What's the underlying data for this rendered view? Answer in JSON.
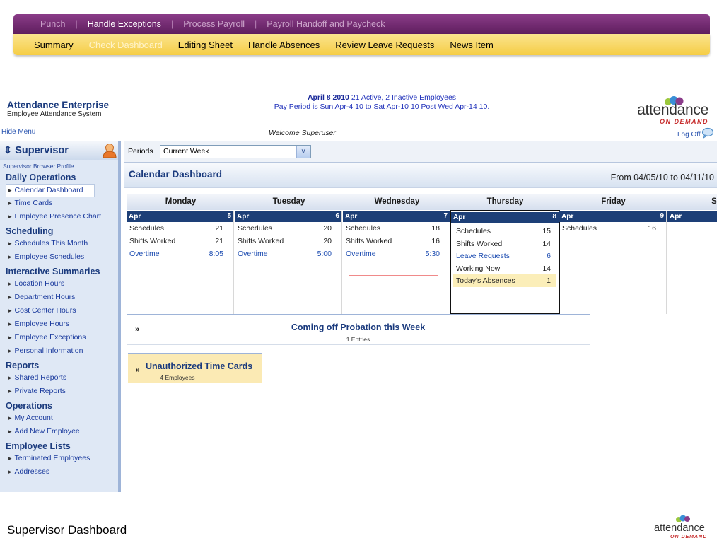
{
  "topnav": {
    "level1": [
      {
        "label": "Punch",
        "active": false
      },
      {
        "label": "Handle Exceptions",
        "active": true
      },
      {
        "label": "Process Payroll",
        "active": false
      },
      {
        "label": "Payroll Handoff and Paycheck",
        "active": false
      }
    ],
    "level2": [
      {
        "label": "Summary",
        "faded": false
      },
      {
        "label": "Check Dashboard",
        "faded": true
      },
      {
        "label": "Editing Sheet",
        "faded": false
      },
      {
        "label": "Handle Absences",
        "faded": false
      },
      {
        "label": "Review Leave Requests",
        "faded": false
      },
      {
        "label": "News Item",
        "faded": false
      }
    ]
  },
  "header": {
    "app_title": "Attendance Enterprise",
    "app_subtitle": "Employee Attendance System",
    "hide_menu": "Hide Menu",
    "date": "April 8 2010",
    "employees": "21 Active, 2 Inactive Employees",
    "pay_period": "Pay Period is Sun Apr-4 10 to Sat Apr-10 10 Post Wed Apr-14 10.",
    "welcome": "Welcome Superuser",
    "logo_word": "attendance",
    "logo_tagline": "ON DEMAND",
    "log_off": "Log Off"
  },
  "sidebar": {
    "role": "Supervisor",
    "profile_link": "Supervisor Browser Profile",
    "sections": [
      {
        "title": "Daily Operations",
        "items": [
          "Calendar Dashboard",
          "Time Cards",
          "Employee Presence Chart"
        ]
      },
      {
        "title": "Scheduling",
        "items": [
          "Schedules This Month",
          "Employee Schedules"
        ]
      },
      {
        "title": "Interactive Summaries",
        "items": [
          "Location Hours",
          "Department Hours",
          "Cost Center Hours",
          "Employee Hours",
          "Employee Exceptions",
          "Personal Information"
        ]
      },
      {
        "title": "Reports",
        "items": [
          "Shared Reports",
          "Private Reports"
        ]
      },
      {
        "title": "Operations",
        "items": [
          "My Account",
          "Add New Employee"
        ]
      },
      {
        "title": "Employee Lists",
        "items": [
          "Terminated Employees",
          "Addresses"
        ]
      }
    ],
    "selected_item": "Calendar Dashboard"
  },
  "main": {
    "periods_label": "Periods",
    "periods_value": "Current Week",
    "dashboard_title": "Calendar Dashboard",
    "date_range": "From 04/05/10 to 04/11/10",
    "days": [
      {
        "name": "Monday",
        "month": "Apr",
        "day": "5",
        "rows": [
          {
            "label": "Schedules",
            "value": "21",
            "link": false
          },
          {
            "label": "Shifts Worked",
            "value": "21",
            "link": false
          },
          {
            "label": "Overtime",
            "value": "8:05",
            "link": true
          }
        ]
      },
      {
        "name": "Tuesday",
        "month": "Apr",
        "day": "6",
        "rows": [
          {
            "label": "Schedules",
            "value": "20",
            "link": false
          },
          {
            "label": "Shifts Worked",
            "value": "20",
            "link": false
          },
          {
            "label": "Overtime",
            "value": "5:00",
            "link": true
          }
        ]
      },
      {
        "name": "Wednesday",
        "month": "Apr",
        "day": "7",
        "rows": [
          {
            "label": "Schedules",
            "value": "18",
            "link": false
          },
          {
            "label": "Shifts Worked",
            "value": "16",
            "link": false
          },
          {
            "label": "Overtime",
            "value": "5:30",
            "link": true
          }
        ]
      },
      {
        "name": "Thursday",
        "month": "Apr",
        "day": "8",
        "rows": [
          {
            "label": "Schedules",
            "value": "15",
            "link": false
          },
          {
            "label": "Shifts Worked",
            "value": "14",
            "link": false
          },
          {
            "label": "Leave Requests",
            "value": "6",
            "link": true
          },
          {
            "label": "Working Now",
            "value": "14",
            "link": false
          },
          {
            "label": "Today's Absences",
            "value": "1",
            "link": false,
            "highlight": true
          }
        ]
      },
      {
        "name": "Friday",
        "month": "Apr",
        "day": "9",
        "rows": [
          {
            "label": "Schedules",
            "value": "16",
            "link": false
          }
        ]
      },
      {
        "name": "Sat",
        "month": "Apr",
        "day": "",
        "rows": []
      }
    ],
    "probation": {
      "title": "Coming off Probation this Week",
      "subtitle": "1 Entries"
    },
    "unauthorized": {
      "title": "Unauthorized Time Cards",
      "subtitle": "4 Employees"
    }
  },
  "footer": {
    "title": "Supervisor Dashboard",
    "logo_word": "attendance",
    "logo_tagline": "ON DEMAND"
  },
  "colors": {
    "nav_purple": "#6b2569",
    "nav_yellow": "#f7d35a",
    "brand_blue": "#1a3a7d",
    "day_header": "#1d3f77",
    "highlight": "#fbeeb9"
  }
}
